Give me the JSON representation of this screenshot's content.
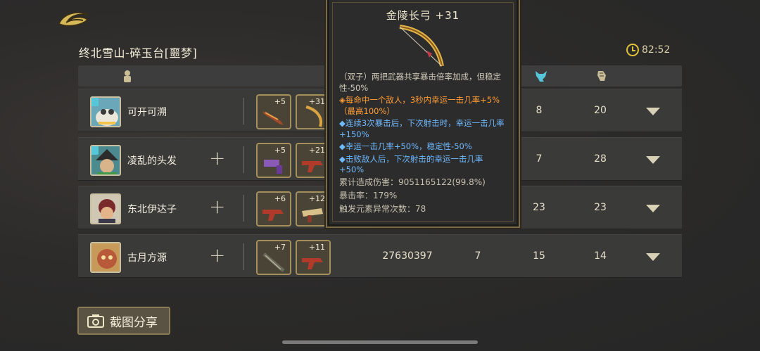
{
  "header": {
    "level_title": "终北雪山-碎玉台[噩梦]",
    "timer": "82:52"
  },
  "rows": [
    {
      "name": "可开可溯",
      "has_plus": false,
      "weapons": [
        "+5",
        "+31"
      ],
      "damage": "",
      "col_a": "",
      "col_b": "8",
      "col_c": "20"
    },
    {
      "name": "凌乱的头发",
      "has_plus": true,
      "weapons": [
        "+5",
        "+21"
      ],
      "damage": "",
      "col_a": "",
      "col_b": "7",
      "col_c": "28"
    },
    {
      "name": "东北伊达子",
      "has_plus": true,
      "weapons": [
        "+6",
        "+12"
      ],
      "damage": "",
      "col_a": "",
      "col_b": "23",
      "col_c": "23"
    },
    {
      "name": "古月方源",
      "has_plus": true,
      "weapons": [
        "+7",
        "+11"
      ],
      "damage": "27630397",
      "col_a": "7",
      "col_b": "15",
      "col_c": "14"
    }
  ],
  "tooltip": {
    "title": "金陵长弓 +31",
    "passive": "（双子）两把武器共享暴击倍率加成，但稳定性-50%",
    "effects": [
      {
        "text": "◈每命中一个敌人，3秒内幸运一击几率+5%（最高100%）",
        "color": "orange"
      },
      {
        "text": "◆连续3次暴击后，下次射击时，幸运一击几率+150%",
        "color": "blue"
      },
      {
        "text": "◆幸运一击几率+50%，稳定性-50%",
        "color": "blue"
      },
      {
        "text": "◆击败敌人后，下次射击的幸运一击几率+50%",
        "color": "blue"
      }
    ],
    "stats": [
      "累计造成伤害：9051165122(99.8%)",
      "暴击率：179%",
      "触发元素异常次数：78"
    ]
  },
  "share_button": "截图分享",
  "colors": {
    "orange_effect": "#ff9d36",
    "blue_effect": "#6fb9ff",
    "gold_accent": "#e0c23a"
  },
  "icons": [
    "back-icon",
    "clock-icon",
    "player-icon",
    "fox-icon",
    "scroll-icon",
    "camera-icon",
    "chevron-down-icon",
    "plus-icon"
  ]
}
